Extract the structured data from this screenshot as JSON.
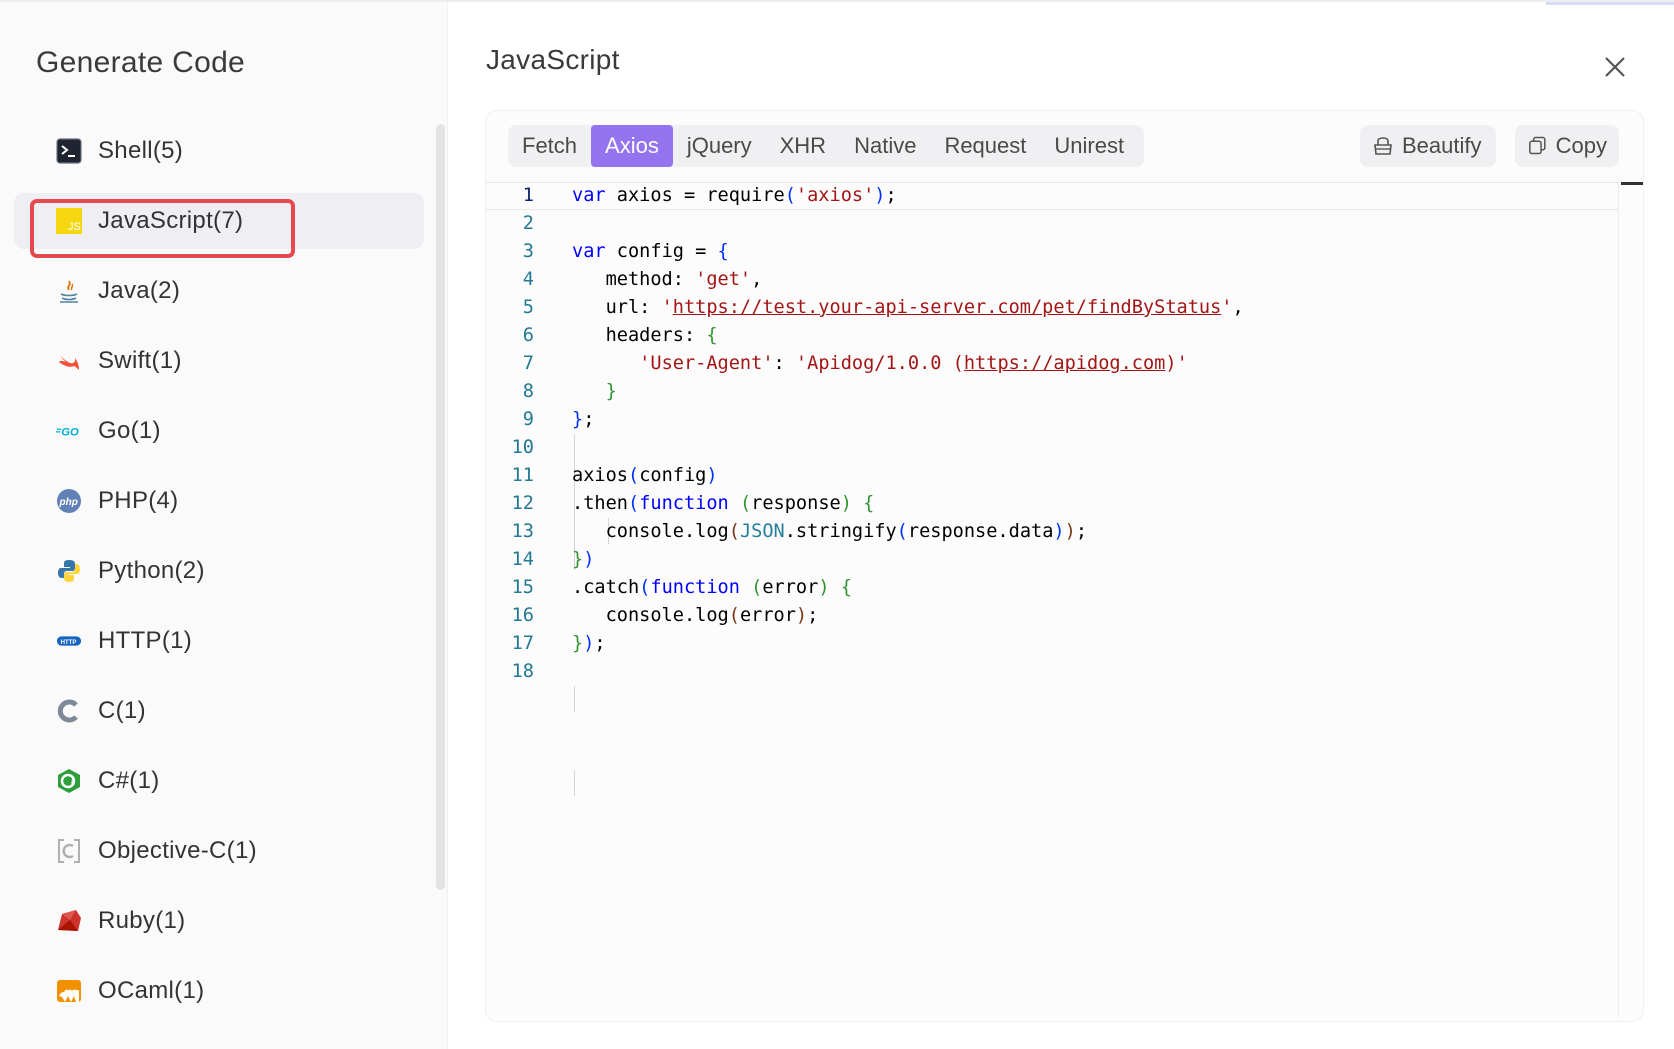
{
  "sidebar": {
    "title": "Generate Code",
    "languages": [
      {
        "label": "Shell(5)",
        "icon": "terminal-icon"
      },
      {
        "label": "JavaScript(7)",
        "icon": "javascript-icon",
        "active": true
      },
      {
        "label": "Java(2)",
        "icon": "java-icon"
      },
      {
        "label": "Swift(1)",
        "icon": "swift-icon"
      },
      {
        "label": "Go(1)",
        "icon": "go-icon"
      },
      {
        "label": "PHP(4)",
        "icon": "php-icon"
      },
      {
        "label": "Python(2)",
        "icon": "python-icon"
      },
      {
        "label": "HTTP(1)",
        "icon": "http-icon"
      },
      {
        "label": "C(1)",
        "icon": "c-icon"
      },
      {
        "label": "C#(1)",
        "icon": "csharp-icon"
      },
      {
        "label": "Objective-C(1)",
        "icon": "objective-c-icon"
      },
      {
        "label": "Ruby(1)",
        "icon": "ruby-icon"
      },
      {
        "label": "OCaml(1)",
        "icon": "ocaml-icon"
      }
    ]
  },
  "main": {
    "title": "JavaScript",
    "tabs": [
      "Fetch",
      "Axios",
      "jQuery",
      "XHR",
      "Native",
      "Request",
      "Unirest"
    ],
    "active_tab": "Axios",
    "beautify_label": "Beautify",
    "copy_label": "Copy"
  },
  "code": {
    "line_numbers": [
      "1",
      "2",
      "3",
      "4",
      "5",
      "6",
      "7",
      "8",
      "9",
      "10",
      "11",
      "12",
      "13",
      "14",
      "15",
      "16",
      "17",
      "18"
    ],
    "url": "https://test.your-api-server.com/pet/findByStatus",
    "user_agent_header": "User-Agent",
    "user_agent_value_prefix": "Apidog/1.0.0 (",
    "user_agent_url": "https://apidog.com",
    "user_agent_value_suffix": ")"
  },
  "colors": {
    "accent": "#9373ee",
    "highlight": "#e5484d",
    "keyword": "#0000ff",
    "string": "#a31515",
    "line_number": "#237893"
  }
}
